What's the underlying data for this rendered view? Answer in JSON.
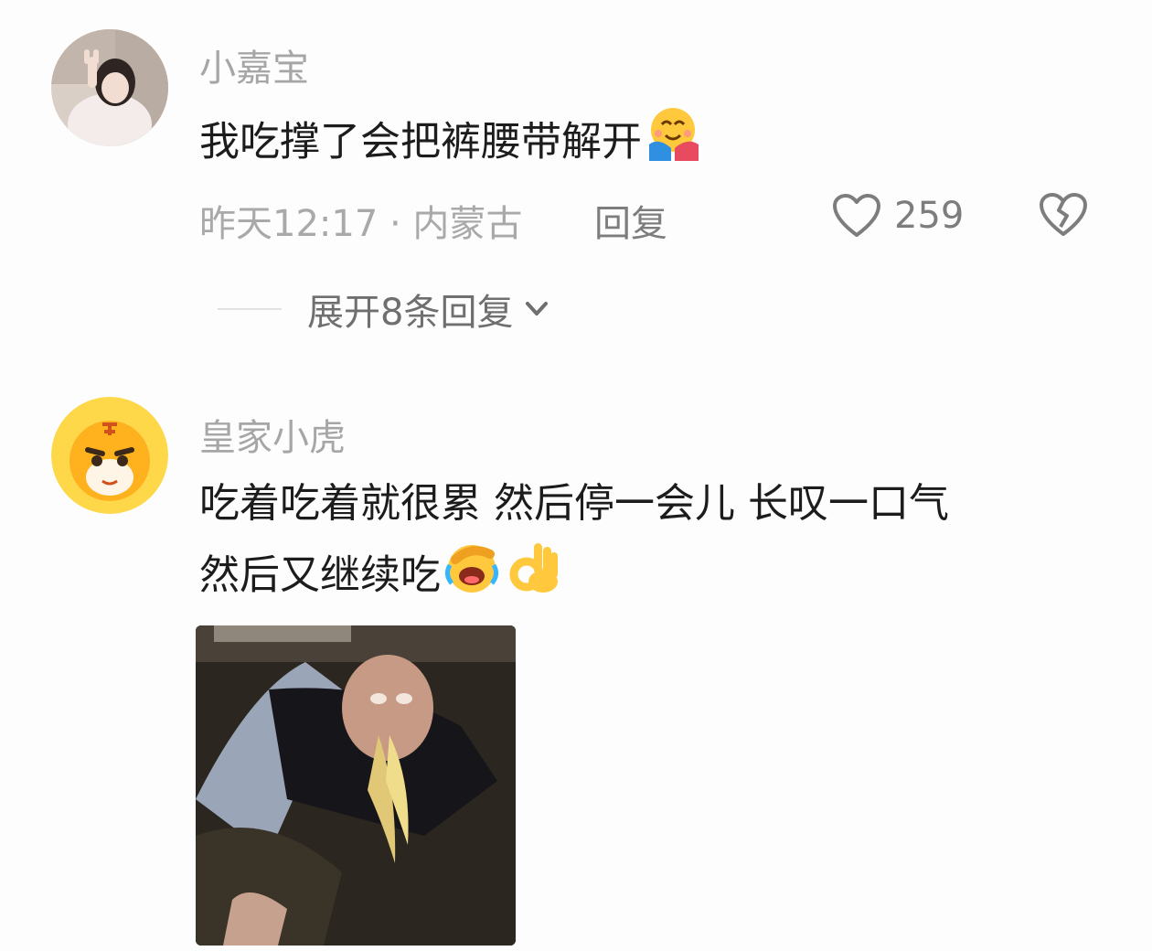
{
  "comments": [
    {
      "username": "小嘉宝",
      "text": "我吃撑了会把裤腰带解开",
      "emoji": "hugging-face-emoji",
      "time_location": "昨天12:17 · 内蒙古",
      "reply_label": "回复",
      "likes": "259",
      "expand_label": "展开8条回复"
    },
    {
      "username": "皇家小虎",
      "text_line1": "吃着吃着就很累 然后停一会儿 长叹一口气",
      "text_line2": "然后又继续吃",
      "emojis": [
        "face-palm-laughing-emoji",
        "ok-hand-emoji"
      ],
      "image": "noodle-meme-photo"
    }
  ],
  "icons": {
    "like": "heart-outline-icon",
    "dislike": "broken-heart-icon",
    "expand": "chevron-down-icon"
  },
  "colors": {
    "username": "#a6a6a6",
    "body": "#1c1c1c",
    "meta": "#a9a9a9",
    "action": "#7d7d7d"
  }
}
